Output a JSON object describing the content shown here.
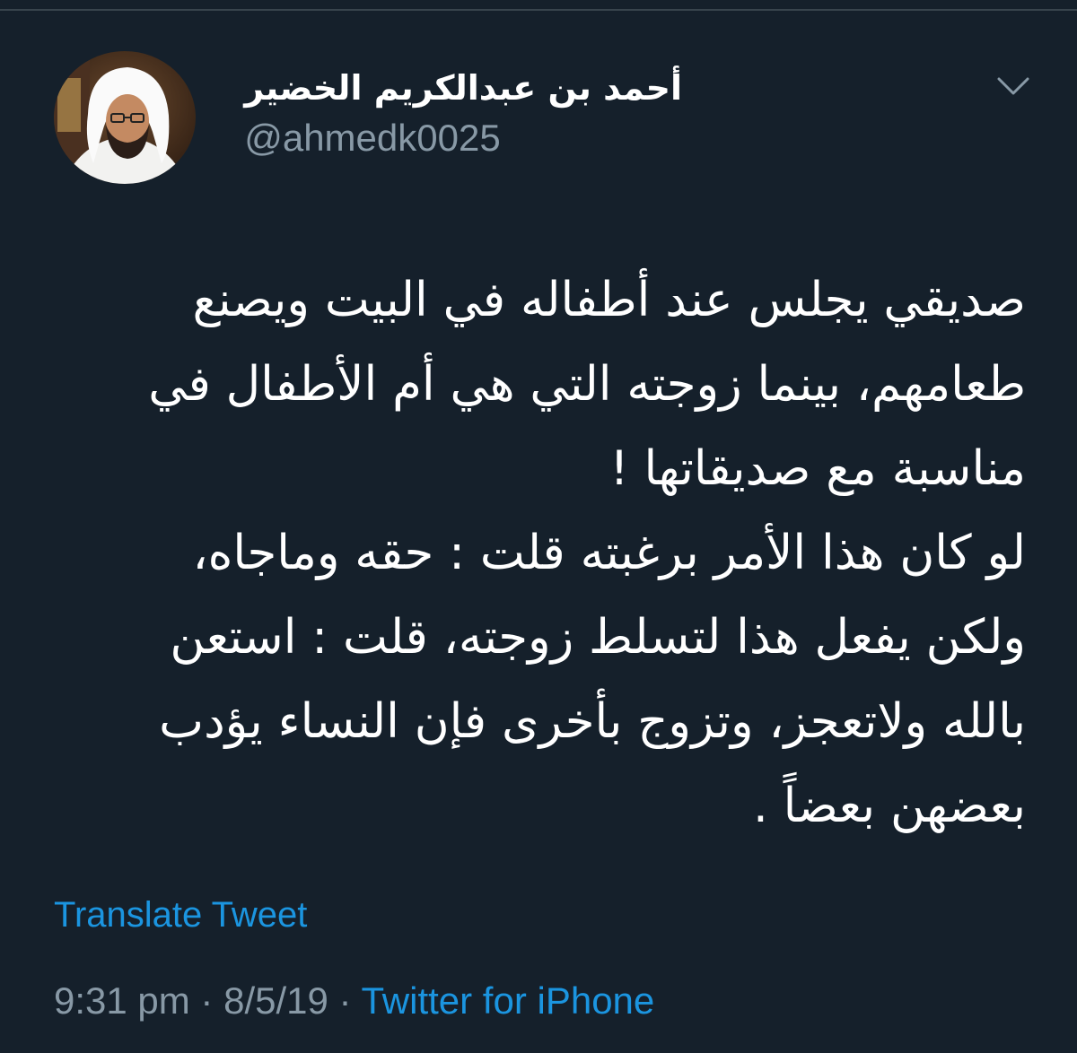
{
  "user": {
    "display_name": "أحمد بن عبدالكريم الخضير",
    "handle": "@ahmedk0025",
    "avatar_icon": "profile-photo"
  },
  "tweet": {
    "lines": [
      "صديقي يجلس عند أطفاله في البيت ويصنع",
      "طعامهم، بينما زوجته التي هي أم الأطفال في",
      "مناسبة مع صديقاتها !",
      "لو كان هذا الأمر برغبته قلت : حقه وماجاه،",
      "ولكن يفعل هذا لتسلط زوجته، قلت : استعن",
      "بالله ولاتعجز، وتزوج بأخرى فإن النساء يؤدب",
      "بعضهن بعضاً ."
    ],
    "translate_label": "Translate Tweet"
  },
  "meta": {
    "time": "9:31 pm",
    "separator": " · ",
    "date": "8/5/19",
    "source": "Twitter for iPhone"
  },
  "colors": {
    "background": "#15202b",
    "text": "#ffffff",
    "secondary": "#8899a6",
    "accent": "#1b95e0"
  }
}
